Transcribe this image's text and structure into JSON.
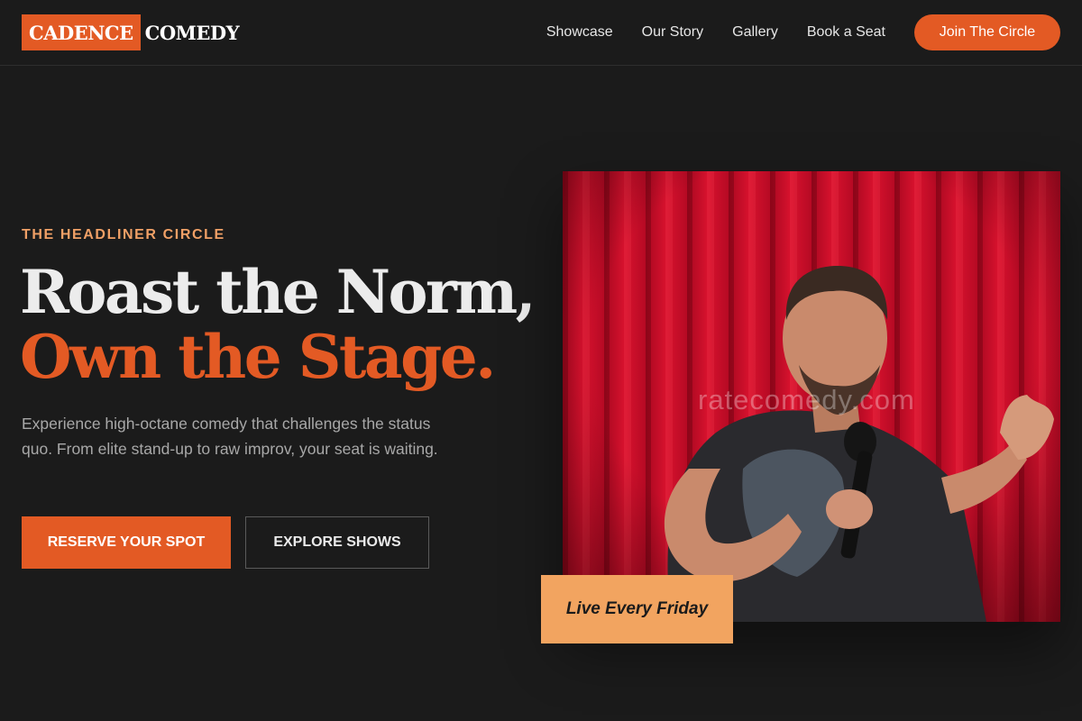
{
  "brand": {
    "box_text": "CADENCE",
    "text": "COMEDY",
    "accent": "#e35a24"
  },
  "nav": {
    "links": [
      "Showcase",
      "Our Story",
      "Gallery",
      "Book a Seat"
    ],
    "cta": "Join The Circle"
  },
  "hero": {
    "eyebrow": "THE HEADLINER CIRCLE",
    "headline_line1": "Roast the Norm,",
    "headline_line2": "Own the Stage.",
    "description": "Experience high-octane comedy that challenges the status quo. From elite stand-up to raw improv, your seat is waiting.",
    "primary_button": "RESERVE YOUR SPOT",
    "secondary_button": "EXPLORE SHOWS"
  },
  "image": {
    "watermark": "ratecomedy.com",
    "badge": "Live Every Friday"
  },
  "colors": {
    "background": "#1b1b1b",
    "accent": "#e35a24",
    "badge": "#f2a460",
    "curtain": "#d0102a"
  }
}
